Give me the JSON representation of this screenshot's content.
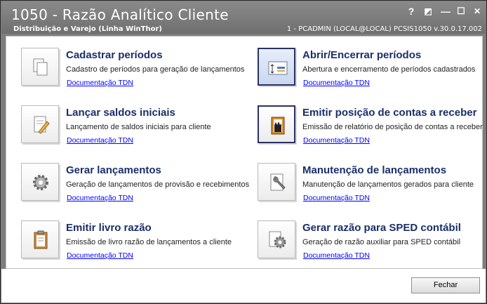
{
  "window": {
    "title": "1050 - Razão Analítico Cliente",
    "subtitle": "Distribuição e Varejo (Linha WinThor)",
    "status": "1 - PCADMIN (LOCAL@LOCAL)   PCSIS1050  v.30.0.17.002",
    "controls": {
      "help": "?",
      "restore": "◩",
      "minimize": "—",
      "maximize": "☐",
      "close": "✕"
    }
  },
  "options": [
    {
      "title": "Cadastrar períodos",
      "description": "Cadastro de períodos para geração de lançamentos",
      "link": "Documentação TDN",
      "icon": "documents-icon"
    },
    {
      "title": "Abrir/Encerrar períodos",
      "description": "Abertura e encerramento de períodos cadastrados",
      "link": "Documentação TDN",
      "icon": "open-close-icon"
    },
    {
      "title": "Lançar saldos iniciais",
      "description": "Lançamento de saldos iniciais para cliente",
      "link": "Documentação TDN",
      "icon": "edit-document-icon"
    },
    {
      "title": "Emitir posição de contas a receber",
      "description": "Emissão de relatório de posição de contas a receber",
      "link": "Documentação TDN",
      "icon": "report-hand-icon"
    },
    {
      "title": "Gerar lançamentos",
      "description": "Geração de lançamentos de provisão e recebimentos",
      "link": "Documentação TDN",
      "icon": "gear-icon"
    },
    {
      "title": "Manutenção de lançamentos",
      "description": "Manutenção de lançamentos gerados para cliente",
      "link": "Documentação TDN",
      "icon": "wrench-document-icon"
    },
    {
      "title": "Emitir livro razão",
      "description": "Emissão de livro razão de lançamentos a cliente",
      "link": "Documentação TDN",
      "icon": "clipboard-icon"
    },
    {
      "title": "Gerar razão para SPED contábil",
      "description": "Geração de razão auxiliar para SPED contábil",
      "link": "Documentação TDN",
      "icon": "gear-document-icon"
    }
  ],
  "footer": {
    "close_label": "Fechar"
  },
  "colors": {
    "title_bar": "#7d7d7d",
    "card_title": "#1a2f6a",
    "link": "#0000ff"
  }
}
